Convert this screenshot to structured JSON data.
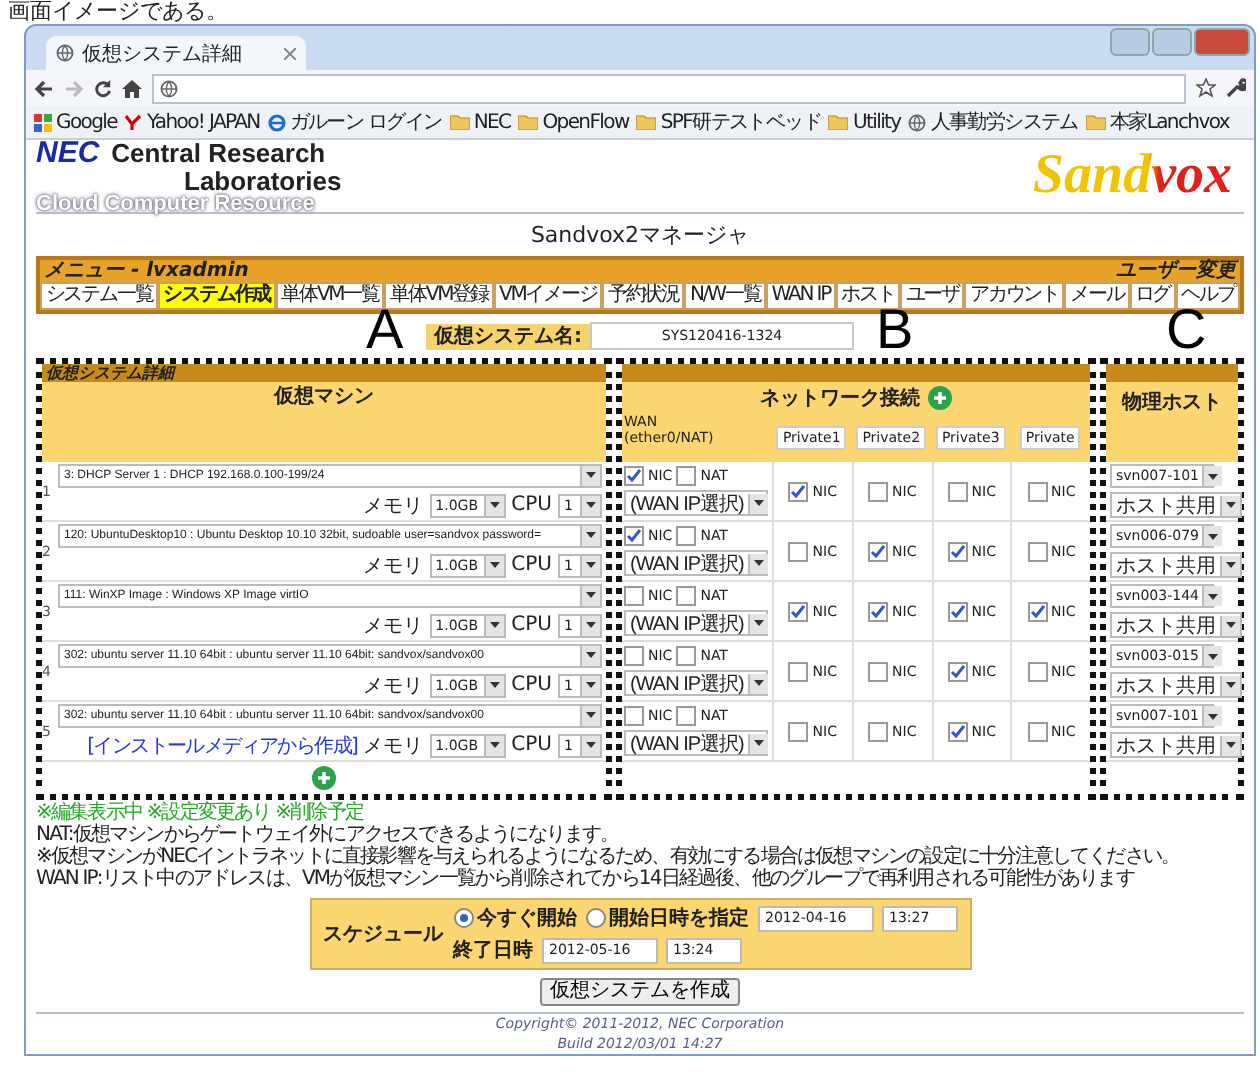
{
  "caption": "画面イメージである。",
  "browser": {
    "tab_title": "仮想システム詳細",
    "bookmarks": [
      {
        "label": "Google",
        "kind": "google"
      },
      {
        "label": "Yahoo! JAPAN",
        "kind": "yahoo"
      },
      {
        "label": "ガルーン ログイン",
        "kind": "ie"
      },
      {
        "label": "NEC",
        "kind": "folder"
      },
      {
        "label": "OpenFlow",
        "kind": "folder"
      },
      {
        "label": "SPF研テストベッド",
        "kind": "folder"
      },
      {
        "label": "Utility",
        "kind": "folder"
      },
      {
        "label": "人事勤労システム",
        "kind": "page"
      },
      {
        "label": "本家Lanchvox",
        "kind": "folder"
      }
    ]
  },
  "header": {
    "org": "NEC",
    "lab_line1": "Central Research",
    "lab_line2": "Laboratories",
    "subtitle": "Cloud Computer Resource",
    "product": "Sandvox"
  },
  "page_title": "Sandvox2マネージャ",
  "menu": {
    "title": "メニュー - lvxadmin",
    "user_link": "ユーザー変更",
    "items": [
      {
        "label": "システム一覧",
        "selected": false
      },
      {
        "label": "システム作成",
        "selected": true
      },
      {
        "label": "単体VM一覧",
        "selected": false
      },
      {
        "label": "単体VM登録",
        "selected": false
      },
      {
        "label": "VMイメージ",
        "selected": false
      },
      {
        "label": "予約状況",
        "selected": false
      },
      {
        "label": "N/W一覧",
        "selected": false
      },
      {
        "label": "WAN IP",
        "selected": false
      },
      {
        "label": "ホスト",
        "selected": false
      },
      {
        "label": "ユーザ",
        "selected": false
      },
      {
        "label": "アカウント",
        "selected": false
      },
      {
        "label": "メール",
        "selected": false
      },
      {
        "label": "ログ",
        "selected": false
      },
      {
        "label": "ヘルプ",
        "selected": false
      }
    ]
  },
  "annotations": [
    "A",
    "B",
    "C"
  ],
  "system_name": {
    "label": "仮想システム名:",
    "value": "SYS120416-1324"
  },
  "detail": {
    "title": "仮想システム詳細",
    "vm_header": "仮想マシン",
    "network_header": "ネットワーク接続",
    "host_header": "物理ホスト",
    "wan_header": [
      "WAN",
      "(ether0/NAT)"
    ],
    "private_columns": [
      "Private1",
      "Private2",
      "Private3",
      "Private"
    ],
    "rows": [
      {
        "number": "1",
        "image": "3: DHCP Server 1 : DHCP 192.168.0.100-199/24",
        "memory_label": "メモリ",
        "memory": "1.0GB",
        "cpu_label": "CPU",
        "cpu": "1",
        "wan_nic": true,
        "wan_nat": false,
        "nic_label": "NIC",
        "nat_label": "NAT",
        "wan_ip": "(WAN IP選択)",
        "private": [
          {
            "label": "NIC",
            "checked": true
          },
          {
            "label": "NIC",
            "checked": false
          },
          {
            "label": "NIC",
            "checked": false
          },
          {
            "label": "NIC",
            "checked": false
          }
        ],
        "host": "svn007-101",
        "host_mode": "ホスト共用"
      },
      {
        "number": "2",
        "image": "120: UbuntuDesktop10 : Ubuntu Desktop 10.10 32bit, sudoable user=sandvox password=",
        "memory_label": "メモリ",
        "memory": "1.0GB",
        "cpu_label": "CPU",
        "cpu": "1",
        "wan_nic": true,
        "wan_nat": false,
        "nic_label": "NIC",
        "nat_label": "NAT",
        "wan_ip": "(WAN IP選択)",
        "private": [
          {
            "label": "NIC",
            "checked": false
          },
          {
            "label": "NIC",
            "checked": true
          },
          {
            "label": "NIC",
            "checked": true
          },
          {
            "label": "NIC",
            "checked": false
          }
        ],
        "host": "svn006-079",
        "host_mode": "ホスト共用"
      },
      {
        "number": "3",
        "image": "111: WinXP Image : Windows XP Image virtIO",
        "memory_label": "メモリ",
        "memory": "1.0GB",
        "cpu_label": "CPU",
        "cpu": "1",
        "wan_nic": false,
        "wan_nat": false,
        "nic_label": "NIC",
        "nat_label": "NAT",
        "wan_ip": "(WAN IP選択)",
        "private": [
          {
            "label": "NIC",
            "checked": true
          },
          {
            "label": "NIC",
            "checked": true
          },
          {
            "label": "NIC",
            "checked": true
          },
          {
            "label": "NIC",
            "checked": true
          }
        ],
        "host": "svn003-144",
        "host_mode": "ホスト共用"
      },
      {
        "number": "4",
        "image": "302: ubuntu server 11.10 64bit : ubuntu server 11.10 64bit: sandvox/sandvox00",
        "memory_label": "メモリ",
        "memory": "1.0GB",
        "cpu_label": "CPU",
        "cpu": "1",
        "wan_nic": false,
        "wan_nat": false,
        "nic_label": "NIC",
        "nat_label": "NAT",
        "wan_ip": "(WAN IP選択)",
        "private": [
          {
            "label": "NIC",
            "checked": false
          },
          {
            "label": "NIC",
            "checked": false
          },
          {
            "label": "NIC",
            "checked": true
          },
          {
            "label": "NIC",
            "checked": false
          }
        ],
        "host": "svn003-015",
        "host_mode": "ホスト共用"
      },
      {
        "number": "5",
        "image": "302: ubuntu server 11.10 64bit : ubuntu server 11.10 64bit: sandvox/sandvox00",
        "link": "[インストールメディアから作成]",
        "memory_label": "メモリ",
        "memory": "1.0GB",
        "cpu_label": "CPU",
        "cpu": "1",
        "wan_nic": false,
        "wan_nat": false,
        "nic_label": "NIC",
        "nat_label": "NAT",
        "wan_ip": "(WAN IP選択)",
        "private": [
          {
            "label": "NIC",
            "checked": false
          },
          {
            "label": "NIC",
            "checked": false
          },
          {
            "label": "NIC",
            "checked": true
          },
          {
            "label": "NIC",
            "checked": false
          }
        ],
        "host": "svn007-101",
        "host_mode": "ホスト共用"
      }
    ]
  },
  "notes": [
    "※編集表示中 ※設定変更あり ※削除予定",
    "NAT:仮想マシンからゲートウェイ外にアクセスできるようになります。",
    "※仮想マシンがNECイントラネットに直接影響を与えられるようになるため、有効にする場合は仮想マシンの設定に十分注意してください。",
    "WAN IP:リスト中のアドレスは、VMが仮想マシン一覧から削除されてから14日経過後、他のグループで再利用される可能性があります"
  ],
  "schedule": {
    "label": "スケジュール",
    "options": [
      {
        "label": "今すぐ開始",
        "selected": true
      },
      {
        "label": "開始日時を指定",
        "selected": false
      }
    ],
    "start_date": "2012-04-16",
    "start_time": "13:27",
    "end_label": "終了日時",
    "end_date": "2012-05-16",
    "end_time": "13:24"
  },
  "create_button": "仮想システムを作成",
  "footer": {
    "copyright": "Copyright© 2011-2012, NEC Corporation",
    "build": "Build 2012/03/01 14:27"
  }
}
